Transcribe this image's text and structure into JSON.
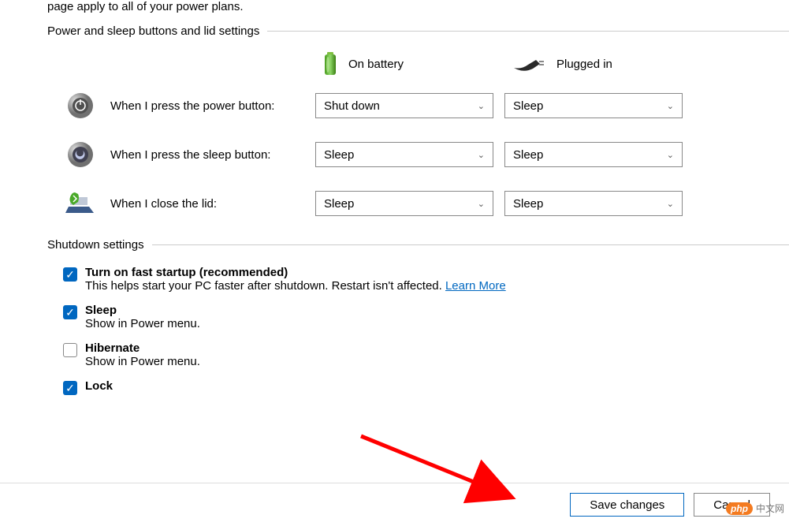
{
  "intro": "page apply to all of your power plans.",
  "section1": {
    "title": "Power and sleep buttons and lid settings",
    "columns": {
      "battery": "On battery",
      "plugged": "Plugged in"
    },
    "rows": [
      {
        "label": "When I press the power button:",
        "battery": "Shut down",
        "plugged": "Sleep"
      },
      {
        "label": "When I press the sleep button:",
        "battery": "Sleep",
        "plugged": "Sleep"
      },
      {
        "label": "When I close the lid:",
        "battery": "Sleep",
        "plugged": "Sleep"
      }
    ]
  },
  "section2": {
    "title": "Shutdown settings",
    "items": [
      {
        "checked": true,
        "title": "Turn on fast startup (recommended)",
        "sub": "This helps start your PC faster after shutdown. Restart isn't affected. ",
        "link": "Learn More"
      },
      {
        "checked": true,
        "title": "Sleep",
        "sub": "Show in Power menu."
      },
      {
        "checked": false,
        "title": "Hibernate",
        "sub": "Show in Power menu."
      },
      {
        "checked": true,
        "title": "Lock",
        "sub": ""
      }
    ]
  },
  "footer": {
    "save": "Save changes",
    "cancel": "Cancel"
  },
  "watermark": {
    "bubble": "php",
    "text": "中文网"
  }
}
